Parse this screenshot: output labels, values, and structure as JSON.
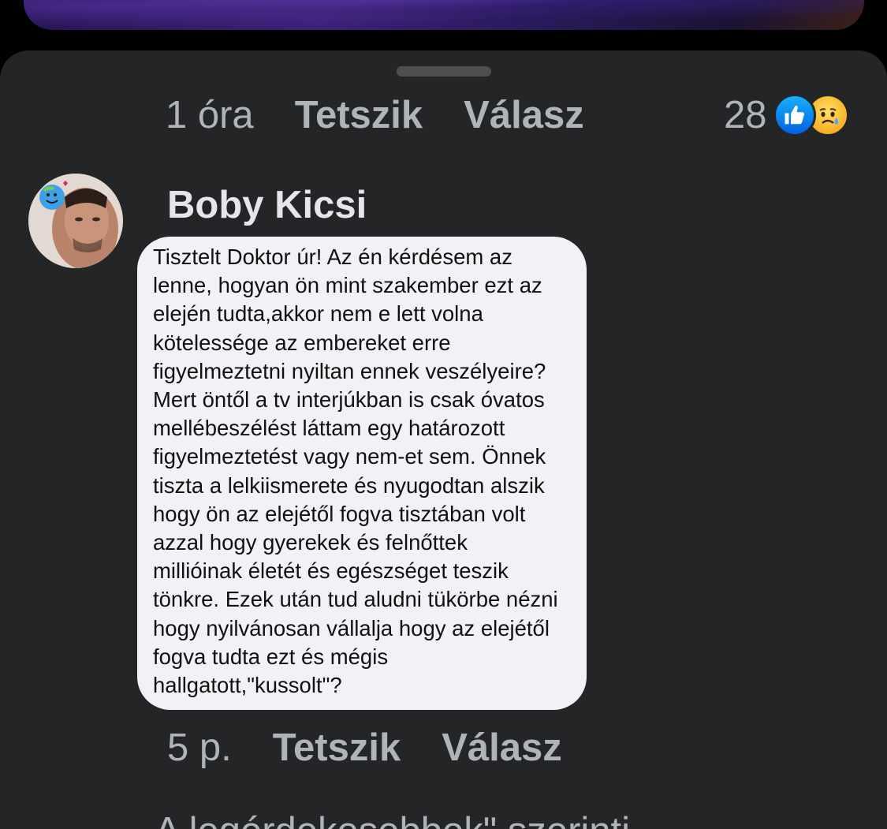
{
  "top_comment": {
    "time": "1 óra",
    "like_label": "Tetszik",
    "reply_label": "Válasz",
    "reaction_count": "28",
    "reactions": [
      "like-icon",
      "sad-icon"
    ]
  },
  "comment": {
    "author": "Boby Kicsi",
    "text": "Tisztelt Doktor úr! Az én kérdésem az\nlenne, hogyan ön mint szakember ezt az\nelején tudta,akkor nem e lett volna\nkötelessége az embereket erre\nfigyelmeztetni nyiltan ennek veszélyeire?\nMert öntől a tv interjúkban is csak óvatos\nmellébeszélést láttam egy határozott\nfigyelmeztetést vagy nem-et sem. Önnek\ntiszta a lelkiismerete és nyugodtan alszik\nhogy ön az elejétől fogva tisztában volt\nazzal hogy gyerekek és felnőttek\nmillióinak életét és egészséget teszik\ntönkre. Ezek után tud aludni tükörbe nézni\nhogy nyilvánosan vállalja hogy az elejétől\nfogva tudta ezt és mégis\nhallgatott,\"kussolt\"?",
    "time": "5 p.",
    "like_label": "Tetszik",
    "reply_label": "Válasz"
  },
  "footer": {
    "partial_text": "A legérdekesebbek\" szerinti"
  },
  "colors": {
    "sheet_background": "#242526",
    "meta_text": "#b0b3b8",
    "name_text": "#e4e6eb",
    "bubble_background": "#f0f2f5",
    "like_blue": "#0866ff"
  }
}
